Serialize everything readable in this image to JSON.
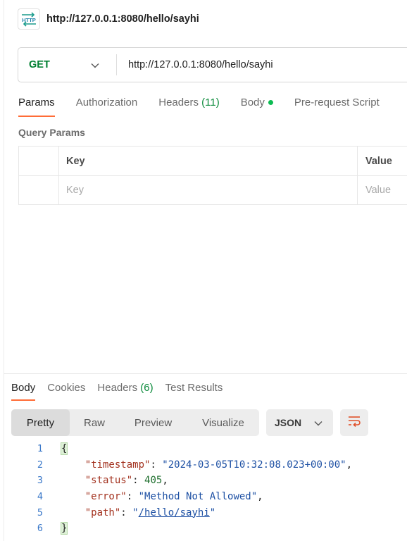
{
  "request": {
    "title": "http://127.0.0.1:8080/hello/sayhi",
    "method": "GET",
    "url": "http://127.0.0.1:8080/hello/sayhi"
  },
  "request_tabs": {
    "params": "Params",
    "authorization": "Authorization",
    "headers": "Headers",
    "headers_count": "(11)",
    "body": "Body",
    "prerequest": "Pre-request Script"
  },
  "query_params": {
    "title": "Query Params",
    "key_header": "Key",
    "value_header": "Value",
    "key_placeholder": "Key",
    "value_placeholder": "Value"
  },
  "response_tabs": {
    "body": "Body",
    "cookies": "Cookies",
    "headers": "Headers",
    "headers_count": "(6)",
    "test_results": "Test Results"
  },
  "view_modes": {
    "pretty": "Pretty",
    "raw": "Raw",
    "preview": "Preview",
    "visualize": "Visualize"
  },
  "format": "JSON",
  "response_body": {
    "line_numbers": [
      "1",
      "2",
      "3",
      "4",
      "5",
      "6"
    ],
    "open_brace": "{",
    "close_brace": "}",
    "timestamp_key": "\"timestamp\"",
    "timestamp_value": "\"2024-03-05T10:32:08.023+00:00\"",
    "status_key": "\"status\"",
    "status_value": "405",
    "error_key": "\"error\"",
    "error_value": "\"Method Not Allowed\"",
    "path_key": "\"path\"",
    "path_value": "/hello/sayhi"
  },
  "colors": {
    "accent": "#ff6c37",
    "method_get": "#007f31",
    "body_dot": "#0cbb52"
  }
}
